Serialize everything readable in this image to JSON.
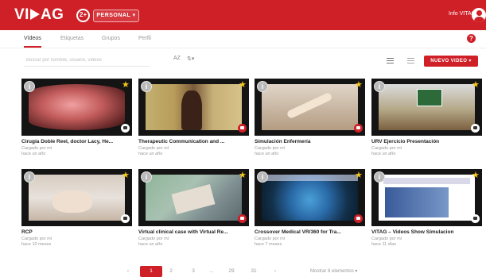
{
  "header": {
    "logo": "VITAG",
    "account_mode": "PERSONAL",
    "info_link": "Info VITAG"
  },
  "tabs": [
    {
      "label": "Vídeos",
      "active": true
    },
    {
      "label": "Etiquetas",
      "active": false
    },
    {
      "label": "Grupos",
      "active": false
    },
    {
      "label": "Perfil",
      "active": false
    }
  ],
  "toolbar": {
    "search_placeholder": "Buscar por nombre, usuario, vídeos",
    "sort_label": "AZ",
    "filter_label": "⇅▾",
    "new_video_label": "NUEVO VIDEO"
  },
  "videos": [
    {
      "title": "Cirugía Doble Reel, doctor Lacy, He...",
      "owner": "Cargado por mí",
      "date": "hace un año",
      "type": "video"
    },
    {
      "title": "Therapeutic Communication and ...",
      "owner": "Cargado por mí",
      "date": "hace un año",
      "type": "youtube"
    },
    {
      "title": "Simulación Enfermería",
      "owner": "Cargado por mí",
      "date": "hace un año",
      "type": "youtube"
    },
    {
      "title": "URV Ejercicio Presentación",
      "owner": "Cargado por mí",
      "date": "hace un año",
      "type": "video"
    },
    {
      "title": "RCP",
      "owner": "Cargado por mí",
      "date": "hace 10 meses",
      "type": "video"
    },
    {
      "title": "Virtual clinical case with Virtual Re...",
      "owner": "Cargado por mí",
      "date": "hace un año",
      "type": "youtube"
    },
    {
      "title": "Crossover Medical VR/360 for Tra...",
      "owner": "Cargado por mí",
      "date": "hace 7 meses",
      "type": "youtube"
    },
    {
      "title": "VITAG – Videos Show Simulacion",
      "owner": "Cargado por mí",
      "date": "hace 11 días",
      "type": "video"
    }
  ],
  "pagination": {
    "prev": "‹",
    "pages": [
      "1",
      "2",
      "3",
      "...",
      "29",
      "31"
    ],
    "next": "›",
    "active": "1",
    "per_page": "Mostrar 8 elementos"
  },
  "colors": {
    "brand": "#cf2027",
    "star": "#f5c518"
  }
}
